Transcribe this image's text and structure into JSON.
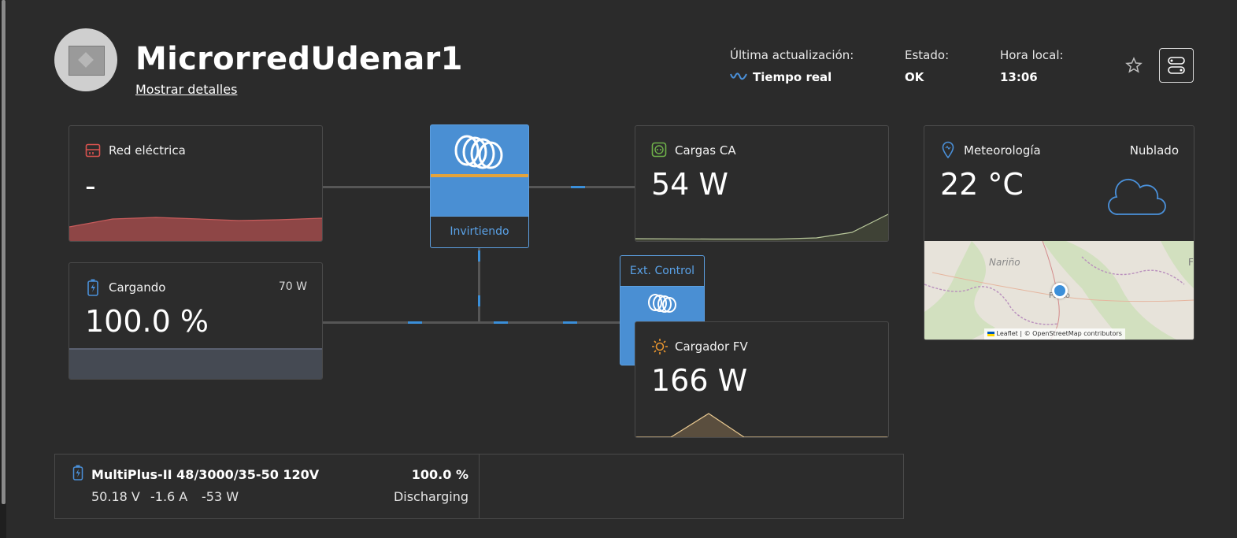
{
  "site": {
    "title": "MicrorredUdenar1",
    "details_link": "Mostrar detalles"
  },
  "status": {
    "last_update_label": "Última actualización:",
    "last_update_value": "Tiempo real",
    "state_label": "Estado:",
    "state_value": "OK",
    "local_time_label": "Hora local:",
    "local_time_value": "13:06"
  },
  "grid": {
    "title": "Red eléctrica",
    "value": "-",
    "color": "#c85a5a"
  },
  "battery": {
    "title": "Cargando",
    "power": "70 W",
    "value": "100.0 %",
    "color": "#4a90d9"
  },
  "inverter": {
    "state": "Invirtiendo"
  },
  "ac_loads": {
    "title": "Cargas CA",
    "value": "54 W",
    "color": "#6fb24a"
  },
  "ext_control": {
    "label": "Ext. Control"
  },
  "pv_charger": {
    "title": "Cargador FV",
    "value": "166 W",
    "color": "#e8952f"
  },
  "weather": {
    "title": "Meteorología",
    "condition": "Nublado",
    "temperature": "22 °C",
    "map_label_region": "Nariño",
    "map_label_city": "Pasto",
    "map_label_edge": "F",
    "attribution": "Leaflet | © OpenStreetMap contributors"
  },
  "device": {
    "name": "MultiPlus-II 48/3000/35-50 120V",
    "soc": "100.0 %",
    "voltage": "50.18 V",
    "current": "-1.6 A",
    "power": "-53 W",
    "state": "Discharging"
  },
  "icons": {
    "grid": "grid-icon",
    "battery": "battery-icon",
    "loads": "outlet-icon",
    "pv": "sun-icon",
    "weather": "location-pin-icon",
    "condition": "cloud-icon",
    "favorite": "star-icon",
    "device_list": "device-list-icon",
    "realtime": "wave-icon"
  }
}
